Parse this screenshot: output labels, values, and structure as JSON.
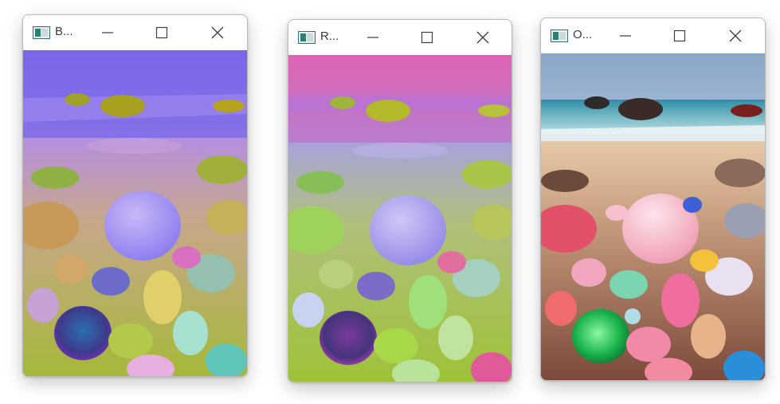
{
  "windows": [
    {
      "title": "B...",
      "view": "bgr"
    },
    {
      "title": "R...",
      "view": "rgb"
    },
    {
      "title": "O...",
      "view": "original"
    }
  ],
  "colors": {
    "window_border": "#b9b9b9",
    "titlebar_bg": "#ffffff",
    "control_glyph": "#404040"
  }
}
